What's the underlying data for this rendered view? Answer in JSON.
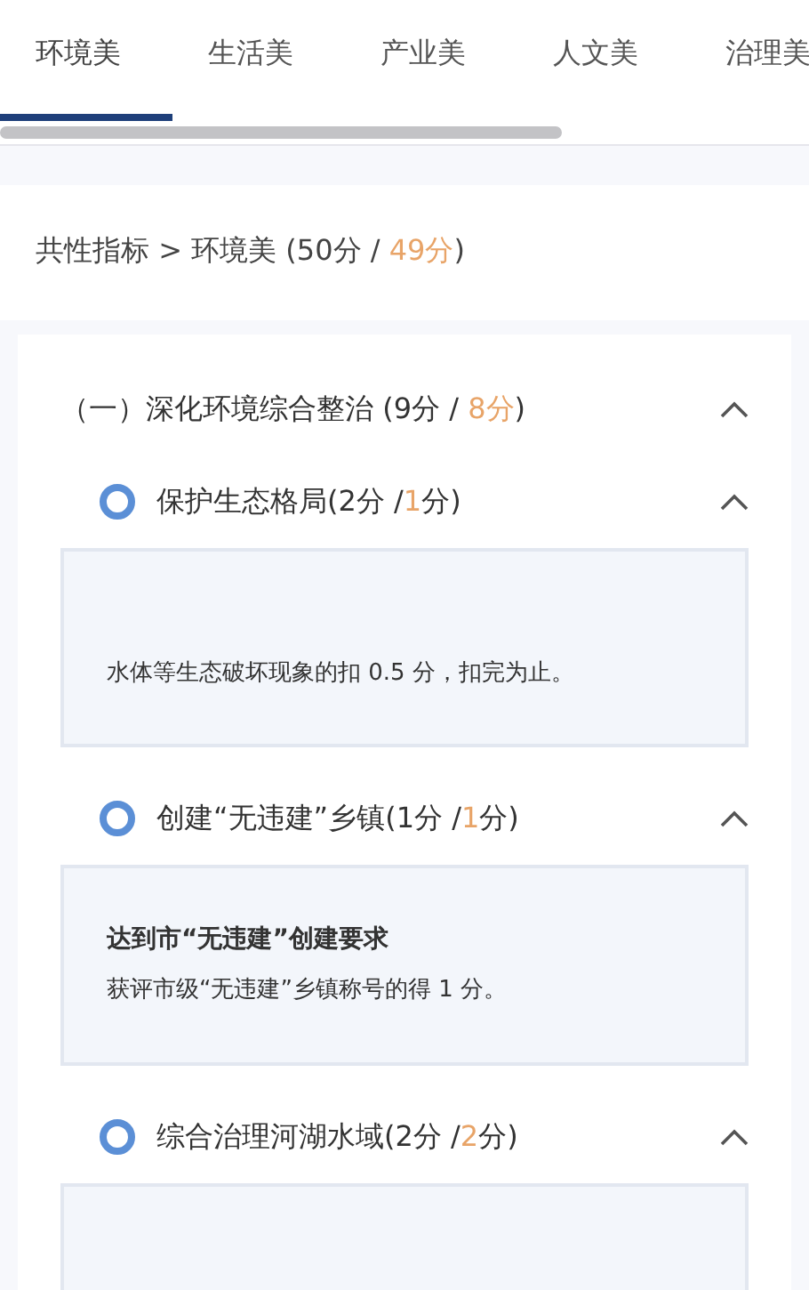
{
  "tabs": [
    {
      "label": "环境美",
      "selected": true
    },
    {
      "label": "生活美",
      "selected": false
    },
    {
      "label": "产业美",
      "selected": false
    },
    {
      "label": "人文美",
      "selected": false
    },
    {
      "label": "治理美",
      "selected": false
    }
  ],
  "breadcrumb": {
    "before": "共性指标 > 环境美 (50分 / ",
    "highlight": "49分",
    "after": ")"
  },
  "section": {
    "before": "（一）深化环境综合整治 (9分 / ",
    "highlight": "8分",
    "after": ")",
    "expanded": true,
    "items": [
      {
        "before": "保护生态格局(2分 /",
        "highlight": "1",
        "after": "分)",
        "expanded": true,
        "detail": {
          "lines": [
            "水体等生态破坏现象的扣 0.5 分，扣完为止。"
          ]
        }
      },
      {
        "before": "创建“无违建”乡镇(1分 /",
        "highlight": "1",
        "after": "分)",
        "expanded": true,
        "detail": {
          "heading": "达到市“无违建”创建要求",
          "lines": [
            "获评市级“无违建”乡镇称号的得 1 分。"
          ]
        }
      },
      {
        "before": "综合治理河湖水域(2分 /",
        "highlight": "2",
        "after": "分)",
        "expanded": true
      }
    ]
  }
}
